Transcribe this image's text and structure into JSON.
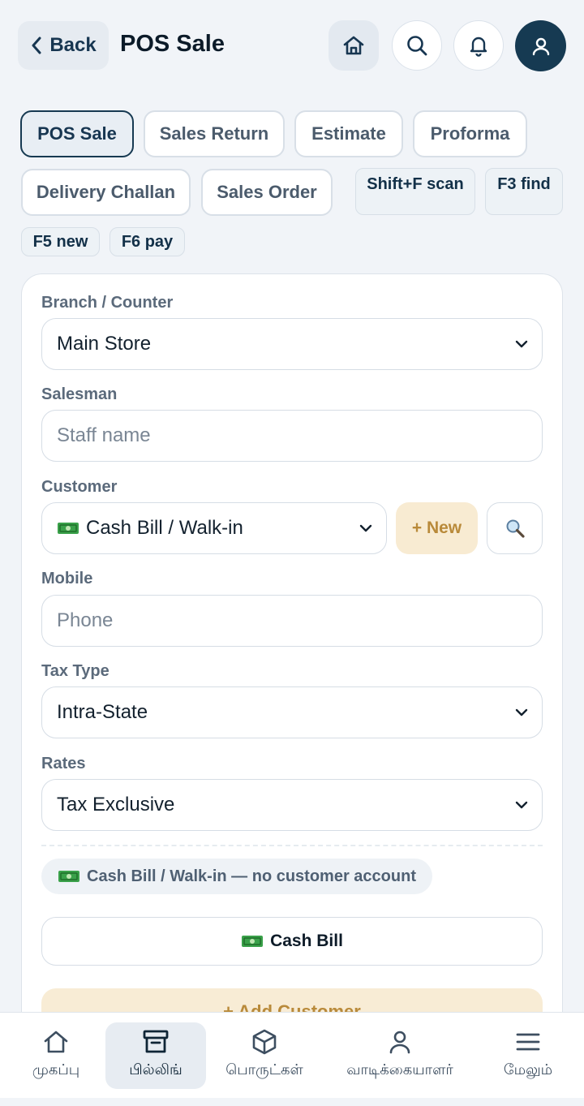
{
  "header": {
    "back_label": "Back",
    "title": "POS Sale",
    "icons": [
      "home-icon",
      "search-icon",
      "bell-icon",
      "user-icon"
    ]
  },
  "doc_types": [
    "POS Sale",
    "Sales Return",
    "Estimate",
    "Proforma",
    "Delivery Challan",
    "Sales Order"
  ],
  "active_doc_type": "POS Sale",
  "shortcuts": [
    "Shift+F scan",
    "F3 find",
    "F5 new",
    "F6 pay"
  ],
  "form": {
    "branch": {
      "label": "Branch / Counter",
      "value": "Main Store"
    },
    "salesman": {
      "label": "Salesman",
      "placeholder": "Staff name"
    },
    "customer": {
      "label": "Customer",
      "value": "Cash Bill / Walk-in",
      "new_label": "+ New"
    },
    "mobile": {
      "label": "Mobile",
      "placeholder": "Phone"
    },
    "tax_type": {
      "label": "Tax Type",
      "value": "Intra-State"
    },
    "rates": {
      "label": "Rates",
      "value": "Tax Exclusive"
    },
    "notice": "Cash Bill / Walk-in — no customer account",
    "cash_bill_label": "Cash Bill",
    "add_customer_label": "+ Add Customer"
  },
  "nav": [
    {
      "label": "முகப்பு",
      "icon": "home-icon"
    },
    {
      "label": "பில்லிங்",
      "icon": "billing-icon"
    },
    {
      "label": "பொருட்கள்",
      "icon": "box-icon"
    },
    {
      "label": "வாடிக்கையாளர்",
      "icon": "customer-icon"
    },
    {
      "label": "மேலும்",
      "icon": "menu-icon"
    }
  ],
  "active_nav": "பில்லிங்",
  "colors": {
    "primary": "#173a52",
    "accent": "#f8ebd2",
    "accent_text": "#b98a3a",
    "background": "#f1f4f8"
  }
}
